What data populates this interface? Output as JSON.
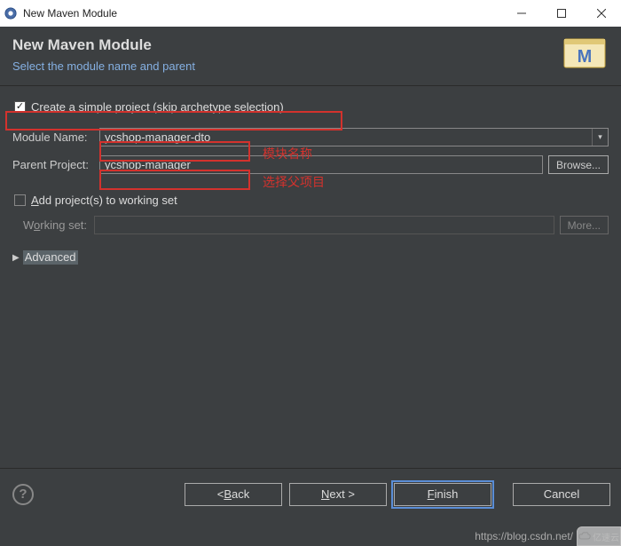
{
  "window": {
    "title": "New Maven Module"
  },
  "header": {
    "title": "New Maven Module",
    "subtitle": "Select the module name and parent"
  },
  "form": {
    "simple_project_label_pre": "Create a ",
    "simple_project_label_u": "s",
    "simple_project_label_post": "imple project (skip archetype selection)",
    "module_name_label": "Module Name:",
    "module_name_value": "ycshop-manager-dto",
    "parent_project_label": "Parent Project:",
    "parent_project_value": "ycshop-manager",
    "browse_label": "Browse...",
    "add_ws_pre": "",
    "add_ws_u": "A",
    "add_ws_post": "dd project(s) to working set",
    "working_set_label_pre": "W",
    "working_set_label_u": "o",
    "working_set_label_post": "rking set:",
    "more_label": "More...",
    "advanced_label": "Advanced"
  },
  "annotations": {
    "module_name_note": "模块名称",
    "parent_project_note": "选择父项目"
  },
  "buttons": {
    "back_lt": "< ",
    "back_u": "B",
    "back_post": "ack",
    "next_u": "N",
    "next_post": "ext >",
    "finish_u": "F",
    "finish_post": "inish",
    "cancel": "Cancel"
  },
  "watermark": {
    "url": "https://blog.csdn.net/",
    "logo": "亿速云"
  }
}
